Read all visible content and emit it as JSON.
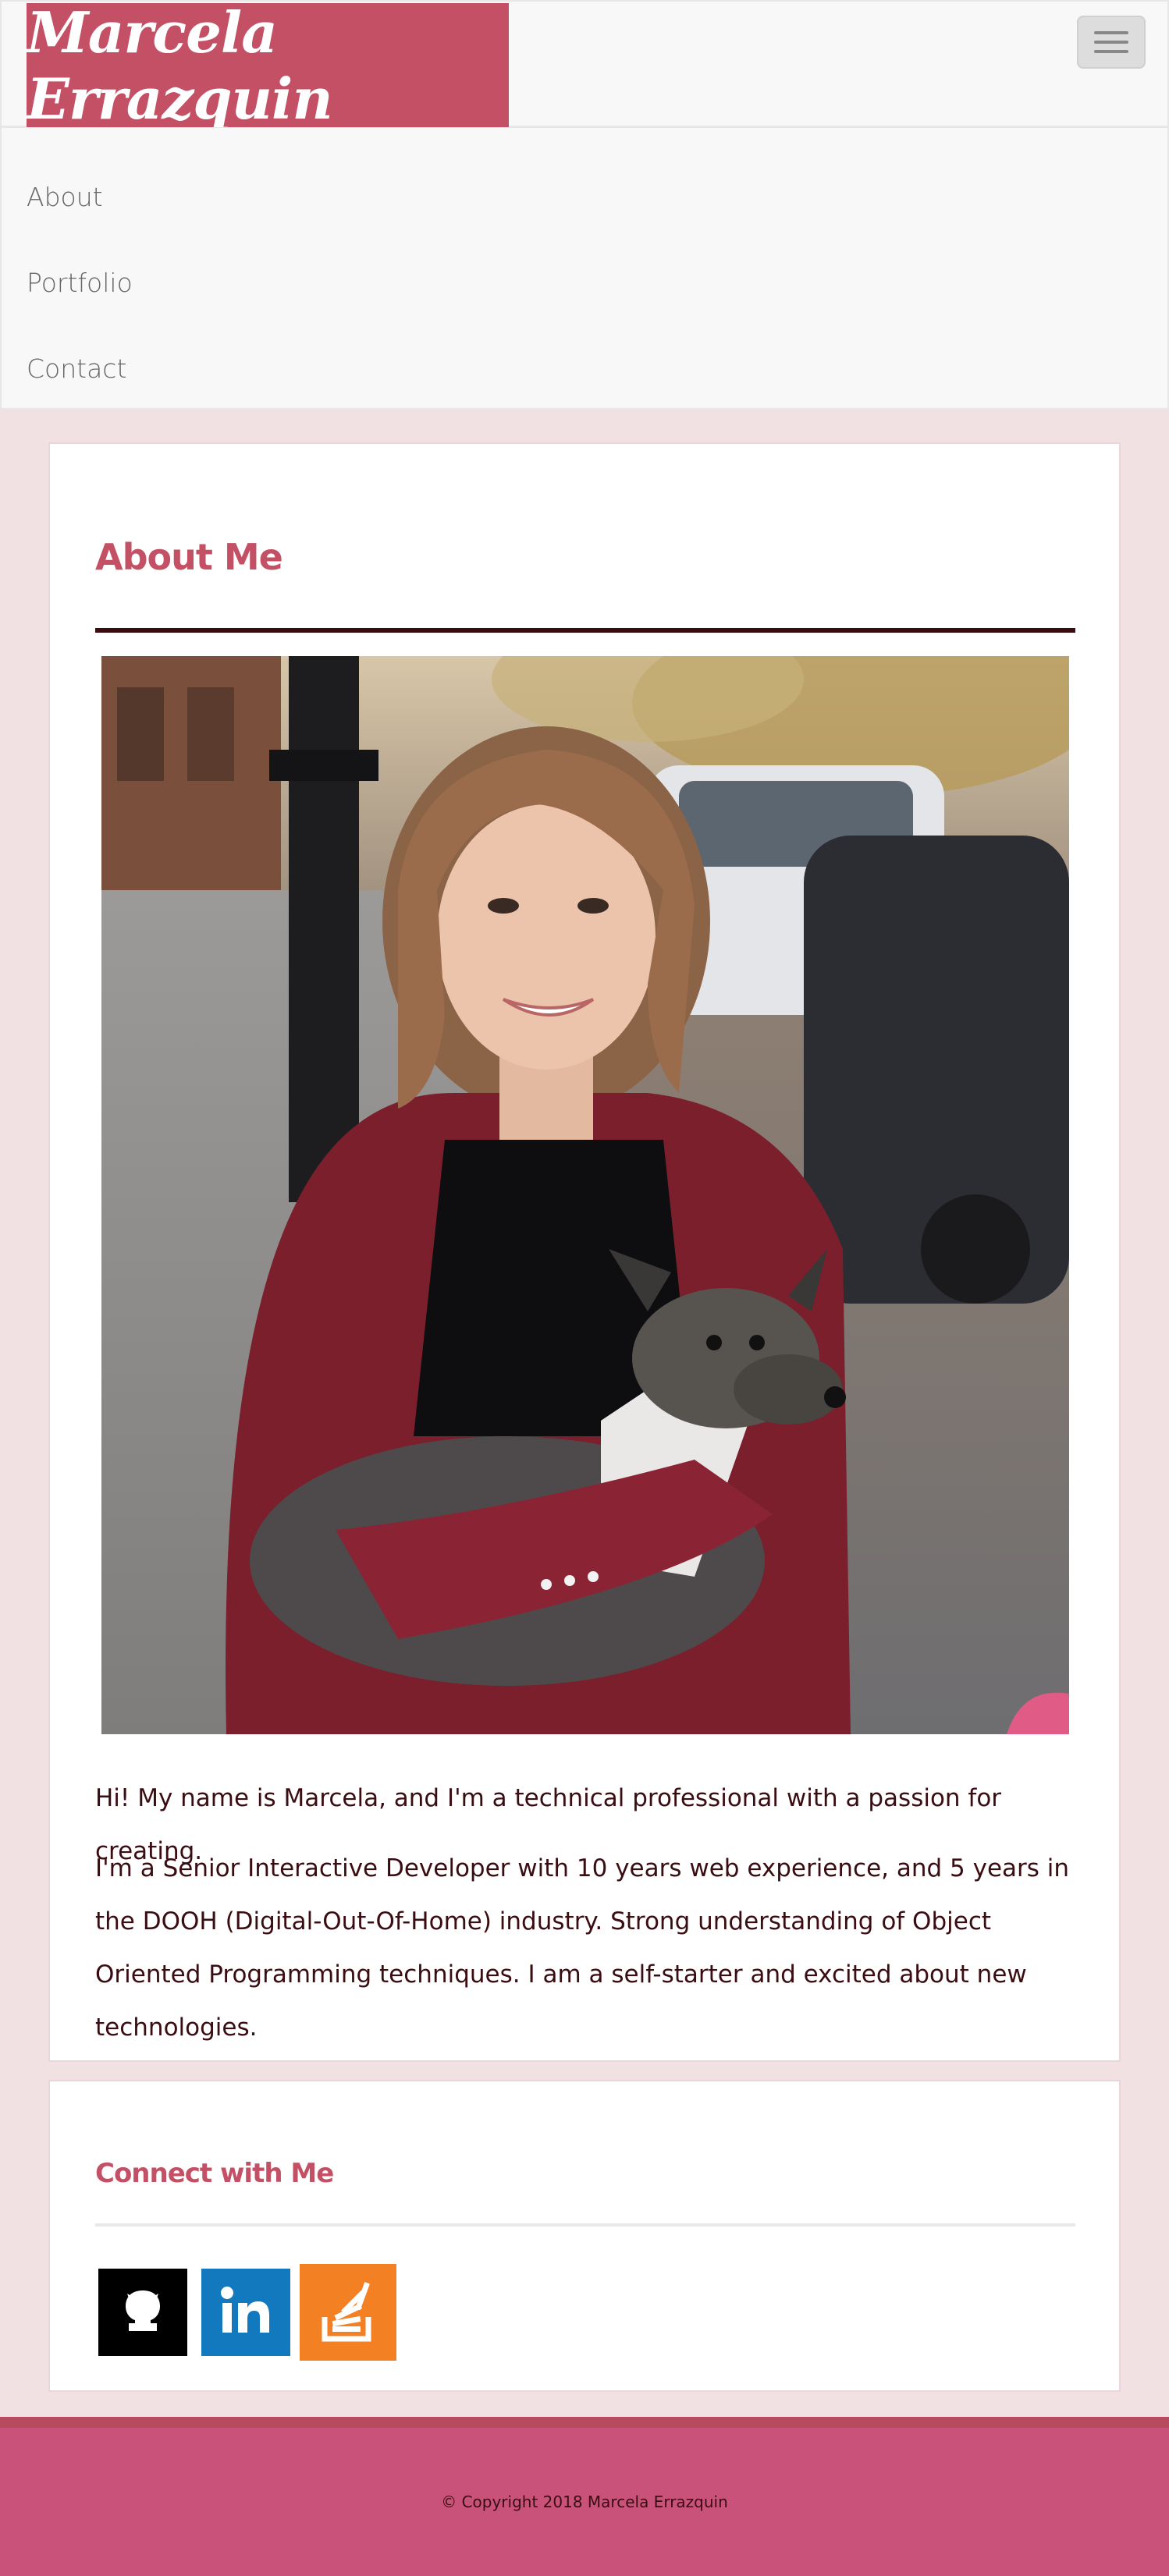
{
  "header": {
    "brand_name": "Marcela Errazquin",
    "brand_color": "#c35065",
    "toggle_icon": "hamburger-icon"
  },
  "nav": {
    "items": [
      {
        "label": "About"
      },
      {
        "label": "Portfolio"
      },
      {
        "label": "Contact"
      }
    ]
  },
  "about": {
    "title": "About Me",
    "photo_alt": "Marcela holding an Italian greyhound",
    "paragraphs": [
      "Hi! My name is Marcela, and I'm a technical professional with a passion for creating.",
      "I'm a Senior Interactive Developer with 10 years web experience, and 5 years in the DOOH (Digital-Out-Of-Home) industry. Strong understanding of Object Oriented Programming techniques. I am a self-starter and excited about new technologies."
    ]
  },
  "connect": {
    "title": "Connect with Me",
    "links": [
      {
        "name": "GitHub",
        "icon": "github-icon",
        "color": "#000000"
      },
      {
        "name": "LinkedIn",
        "icon": "linkedin-icon",
        "color": "#1279be"
      },
      {
        "name": "Stack Overflow",
        "icon": "stackoverflow-icon",
        "color": "#f48024"
      }
    ]
  },
  "footer": {
    "copyright": "© Copyright 2018 Marcela Errazquin",
    "color": "#c9527b"
  }
}
